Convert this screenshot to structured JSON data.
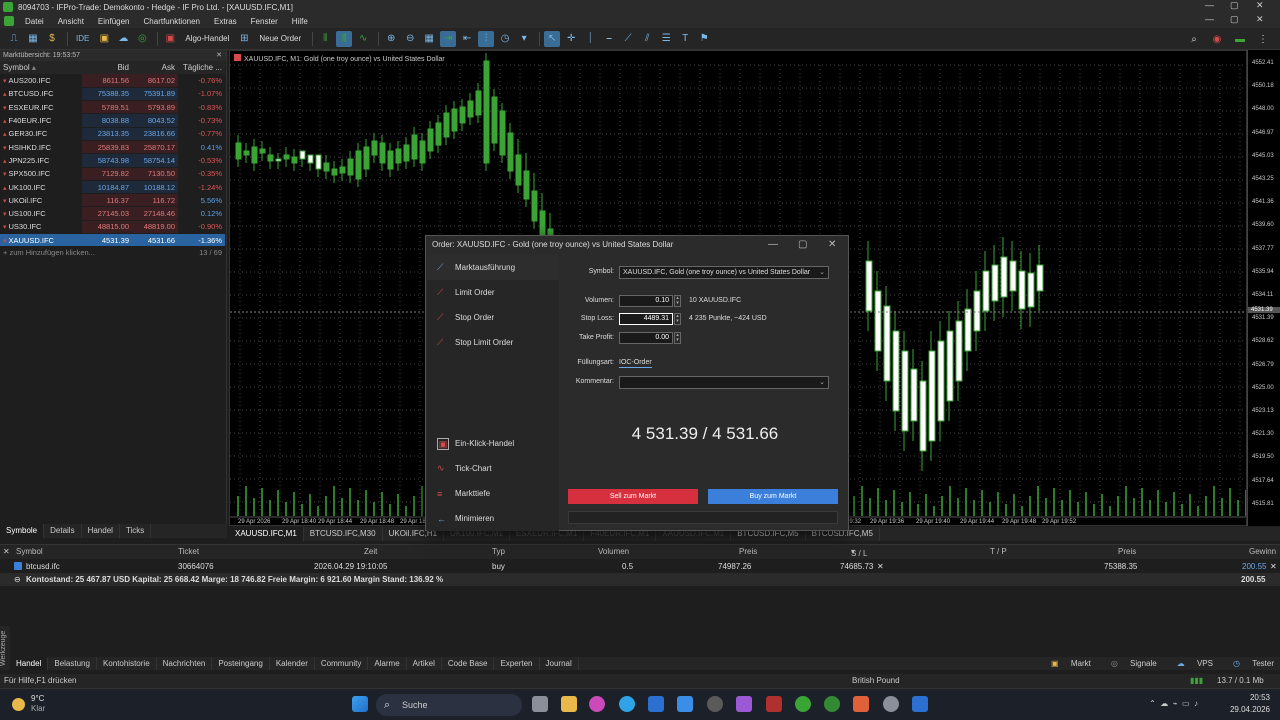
{
  "window": {
    "title": "8094703 - IFPro-Trade: Demokonto - Hedge - IF Pro Ltd. - [XAUUSD.IFC,M1]"
  },
  "menu": [
    "Datei",
    "Ansicht",
    "Einfügen",
    "Chartfunktionen",
    "Extras",
    "Fenster",
    "Hilfe"
  ],
  "toolbar": {
    "algo_label": "Algo-Handel",
    "new_order_label": "Neue Order",
    "ide_label": "IDE"
  },
  "market_watch": {
    "header": "Marktübersicht: 19:53:57",
    "columns": [
      "Symbol",
      "Bid",
      "Ask",
      "Tägliche ..."
    ],
    "rows": [
      {
        "symbol": "AUS200.IFC",
        "bid": "8611.56",
        "ask": "8617.02",
        "change": "-0.76%",
        "dir": "down"
      },
      {
        "symbol": "BTCUSD.IFC",
        "bid": "75388.35",
        "ask": "75391.89",
        "change": "-1.07%",
        "dir": "up"
      },
      {
        "symbol": "ESXEUR.IFC",
        "bid": "5789.51",
        "ask": "5793.89",
        "change": "-0.83%",
        "dir": "down"
      },
      {
        "symbol": "F40EUR.IFC",
        "bid": "8038.88",
        "ask": "8043.52",
        "change": "-0.73%",
        "dir": "up"
      },
      {
        "symbol": "GER30.IFC",
        "bid": "23813.35",
        "ask": "23816.66",
        "change": "-0.77%",
        "dir": "up"
      },
      {
        "symbol": "HSIHKD.IFC",
        "bid": "25839.83",
        "ask": "25870.17",
        "change": "0.41%",
        "dir": "down"
      },
      {
        "symbol": "JPN225.IFC",
        "bid": "58743.98",
        "ask": "58754.14",
        "change": "-0.53%",
        "dir": "up"
      },
      {
        "symbol": "SPX500.IFC",
        "bid": "7129.82",
        "ask": "7130.50",
        "change": "-0.35%",
        "dir": "down"
      },
      {
        "symbol": "UK100.IFC",
        "bid": "10184.87",
        "ask": "10188.12",
        "change": "-1.24%",
        "dir": "up"
      },
      {
        "symbol": "UKOil.IFC",
        "bid": "116.37",
        "ask": "116.72",
        "change": "5.56%",
        "dir": "down"
      },
      {
        "symbol": "US100.IFC",
        "bid": "27145.03",
        "ask": "27148.46",
        "change": "0.12%",
        "dir": "down"
      },
      {
        "symbol": "US30.IFC",
        "bid": "48815.00",
        "ask": "48819.00",
        "change": "-0.90%",
        "dir": "down"
      },
      {
        "symbol": "XAUUSD.IFC",
        "bid": "4531.39",
        "ask": "4531.66",
        "change": "-1.36%",
        "dir": "sel"
      }
    ],
    "add_label": "+ zum Hinzufügen klicken...",
    "count": "13 / 69",
    "tabs": [
      "Symbole",
      "Details",
      "Handel",
      "Ticks"
    ]
  },
  "chart": {
    "title": "XAUUSD.IFC, M1:  Gold (one troy ounce) vs United States Dollar",
    "y_ticks": [
      "4552.41",
      "4550.18",
      "4548.00",
      "4546.97",
      "4545.03",
      "4543.25",
      "4541.36",
      "4539.60",
      "4537.77",
      "4535.94",
      "4534.11",
      "4531.39",
      "4528.62",
      "4526.79",
      "4525.00",
      "4523.13",
      "4521.30",
      "4519.50",
      "4517.64",
      "4515.81"
    ],
    "current_price": "4531.39",
    "x_ticks": [
      "29 Apr 2026",
      "29 Apr 18:40",
      "29 Apr 18:44",
      "29 Apr 18:48",
      "29 Apr 18:52",
      "19:32",
      "29 Apr 19:36",
      "29 Apr 19:40",
      "29 Apr 19:44",
      "29 Apr 19:48",
      "29 Apr 19:52"
    ],
    "tabs": [
      "XAUUSD.IFC,M1",
      "BTCUSD.IFC,M30",
      "UKOil.IFC,H1",
      "UK100.IFC,M1",
      "ESXEUR.IFC,M1",
      "F40EUR.IFC,M1",
      "XAUUSD.IFC,M1",
      "BTCUSD.IFC,M5",
      "BTCUSD.IFC,M5"
    ]
  },
  "order_dialog": {
    "title": "Order: XAUUSD.IFC - Gold (one troy ounce) vs United States Dollar",
    "modes": [
      "Marktausführung",
      "Limit Order",
      "Stop Order",
      "Stop Limit Order"
    ],
    "bottom_modes": [
      "Ein-Klick-Handel",
      "Tick-Chart",
      "Markttiefe",
      "Minimieren"
    ],
    "symbol_label": "Symbol:",
    "symbol_value": "XAUUSD.IFC, Gold (one troy ounce) vs United States Dollar",
    "volume_label": "Volumen:",
    "volume_value": "0.10",
    "volume_note": "10 XAUUSD.IFC",
    "sl_label": "Stop Loss:",
    "sl_value": "4489.31",
    "sl_note": "4 235 Punkte, ~424 USD",
    "tp_label": "Take Profit:",
    "tp_value": "0.00",
    "fill_label": "Füllungsart:",
    "fill_value": "IOC-Order",
    "comment_label": "Kommentar:",
    "prices": "4 531.39 / 4 531.66",
    "sell_label": "Sell zum Markt",
    "buy_label": "Buy zum Markt"
  },
  "trade": {
    "columns": [
      "Symbol",
      "Ticket",
      "Zeit",
      "Typ",
      "Volumen",
      "Preis",
      "S / L",
      "T / P",
      "Preis",
      "Gewinn"
    ],
    "row": {
      "symbol": "btcusd.ifc",
      "ticket": "30664076",
      "time": "2026.04.29 19:10:05",
      "type": "buy",
      "volume": "0.5",
      "price": "74987.26",
      "sl": "74685.73",
      "tp": "",
      "cur_price": "75388.35",
      "profit": "200.55"
    },
    "balance": "Kontostand: 25 467.87 USD  Kapital: 25 668.42  Marge: 18 746.82  Freie Margin: 6 921.60  Margin Stand: 136.92 %",
    "balance_profit": "200.55"
  },
  "toolbox_tabs": [
    "Handel",
    "Belastung",
    "Kontohistorie",
    "Nachrichten",
    "Posteingang",
    "Kalender",
    "Community",
    "Alarme",
    "Artikel",
    "Code Base",
    "Experten",
    "Journal"
  ],
  "toolbox_right": [
    "Markt",
    "Signale",
    "VPS",
    "Tester"
  ],
  "side_label": "Werkzeuge",
  "status": {
    "help": "Für Hilfe,F1 drücken",
    "profile": "British Pound",
    "traffic": "13.7 / 0.1 Mb"
  },
  "taskbar": {
    "temp": "9°C",
    "weather": "Klar",
    "search": "Suche",
    "time": "20:53",
    "date": "29.04.2026"
  },
  "colors": {
    "accent": "#2a64a0",
    "sell": "#d62f3d",
    "buy": "#3c7fdb",
    "bull": "#ffffff",
    "bear": "#3aa535"
  }
}
